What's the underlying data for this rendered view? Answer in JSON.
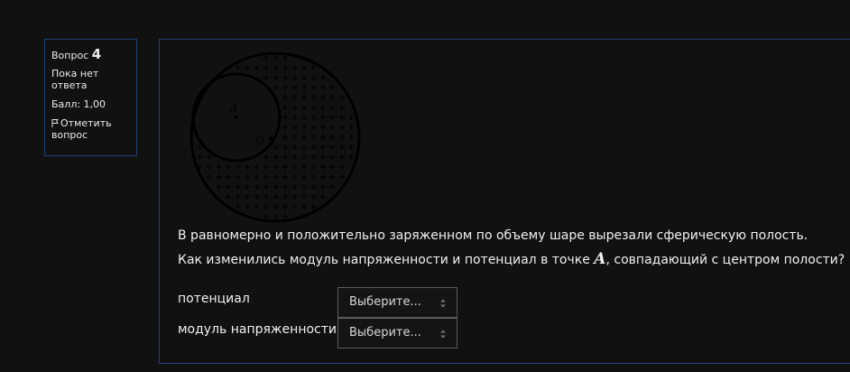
{
  "question_info": {
    "label": "Вопрос",
    "number": "4",
    "state": "Пока нет ответа",
    "grade": "Балл: 1,00",
    "flag_label": "Отметить вопрос"
  },
  "figure": {
    "point_a": "A",
    "point_o": "O"
  },
  "question": {
    "line1": "В равномерно и положительно заряженном по объему шаре вырезали сферическую полость.",
    "line2_before": "Как изменились модуль напряженности и потенциал в точке ",
    "line2_math": "A",
    "line2_after": ", совпадающий с центром полости?"
  },
  "answers": [
    {
      "label": "потенциал",
      "selected": "Выберите..."
    },
    {
      "label": "модуль напряженности",
      "selected": "Выберите..."
    }
  ]
}
